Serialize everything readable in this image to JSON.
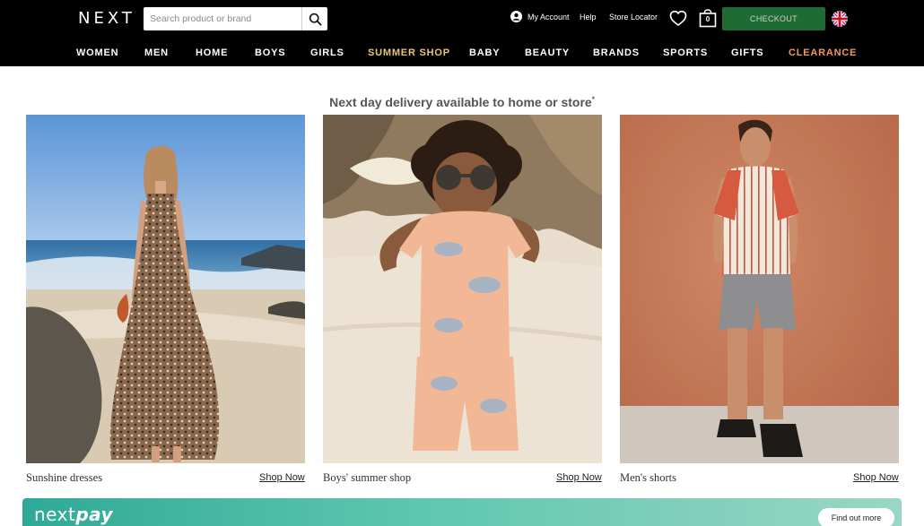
{
  "header": {
    "logo": "NEXT",
    "search_placeholder": "Search product or brand",
    "my_account": "My Account",
    "help": "Help",
    "store_locator": "Store Locator",
    "bag_count": "0",
    "checkout": "CHECKOUT"
  },
  "nav": {
    "items": [
      "WOMEN",
      "MEN",
      "HOME",
      "BOYS",
      "GIRLS",
      "SUMMER SHOP",
      "BABY",
      "BEAUTY",
      "BRANDS",
      "SPORTS",
      "GIFTS",
      "CLEARANCE"
    ],
    "highlight_colors": {
      "summer_shop": "#e8c67a",
      "clearance": "#ef9a5a"
    }
  },
  "promo": {
    "text": "Next day delivery available to home or store",
    "mark": "*"
  },
  "tiles": [
    {
      "caption": "Sunshine dresses",
      "cta": "Shop Now"
    },
    {
      "caption": "Boys' summer shop",
      "cta": "Shop Now"
    },
    {
      "caption": "Men's shorts",
      "cta": "Shop Now"
    }
  ],
  "banner": {
    "logo_next": "next",
    "logo_pay": "pay",
    "cta": "Find out more"
  },
  "colors": {
    "header_bg": "#000000",
    "checkout_bg": "#1f6b34",
    "banner_start": "#2fa997",
    "banner_end": "#9ad6c5"
  }
}
